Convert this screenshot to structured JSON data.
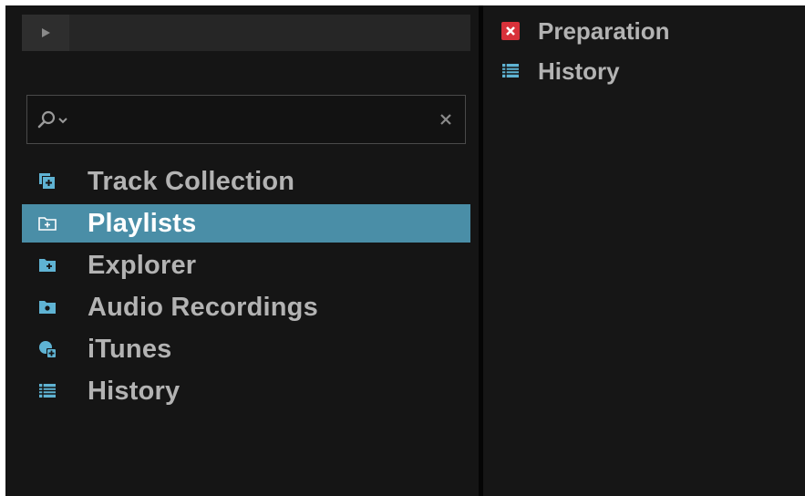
{
  "colors": {
    "accent_blue": "#4a8ea7",
    "icon_blue": "#5fb3d3",
    "prep_red": "#d8313a",
    "text_grey": "#b3b3b3",
    "selected_text": "#ffffff"
  },
  "preview": {
    "play_icon": "play-icon"
  },
  "search": {
    "value": "",
    "placeholder": "",
    "search_icon": "search-icon",
    "dropdown_icon": "chevron-down-icon",
    "clear_icon": "close-icon"
  },
  "tree": {
    "items": [
      {
        "label": "Track Collection",
        "icon": "track-collection-icon",
        "selected": false
      },
      {
        "label": "Playlists",
        "icon": "playlist-folder-icon",
        "selected": true
      },
      {
        "label": "Explorer",
        "icon": "explorer-folder-icon",
        "selected": false
      },
      {
        "label": "Audio Recordings",
        "icon": "audio-recordings-folder-icon",
        "selected": false
      },
      {
        "label": "iTunes",
        "icon": "itunes-icon",
        "selected": false
      },
      {
        "label": "History",
        "icon": "history-list-icon",
        "selected": false
      }
    ]
  },
  "playlists": {
    "items": [
      {
        "label": "Preparation",
        "icon": "preparation-icon"
      },
      {
        "label": "History",
        "icon": "history-list-icon"
      }
    ]
  }
}
